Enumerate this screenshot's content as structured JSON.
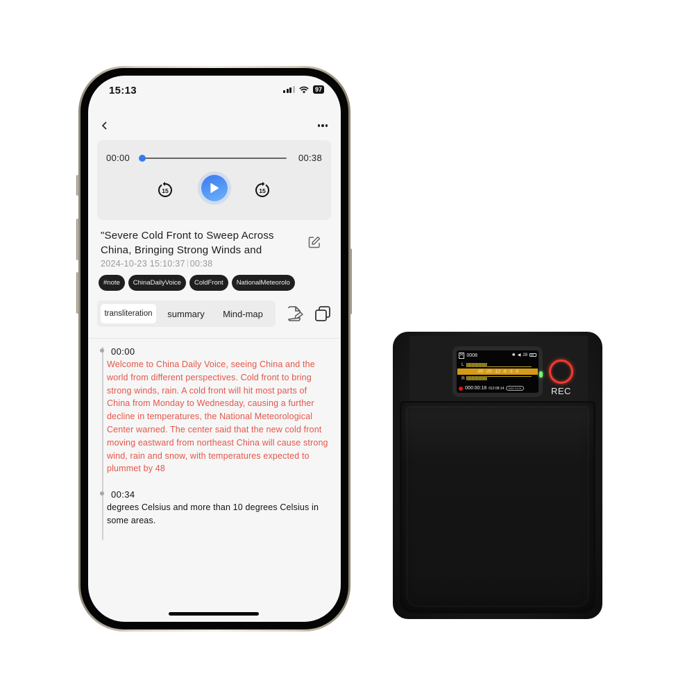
{
  "status_bar": {
    "time": "15:13",
    "battery": "97",
    "icons": [
      "signal-icon",
      "wifi-icon",
      "battery-icon"
    ]
  },
  "nav": {
    "back_icon": "chevron-left-icon",
    "more_icon": "more-horizontal-icon"
  },
  "player": {
    "current_time": "00:00",
    "total_time": "00:38",
    "progress_fraction": 0.0,
    "skip_back_label": "15",
    "skip_forward_label": "15",
    "play_icon": "play-icon",
    "accent_color": "#3a78f2"
  },
  "recording": {
    "title": "\"Severe Cold Front to Sweep Across China, Bringing Strong Winds and",
    "date": "2024-10-23 15:10:37",
    "duration": "00:38",
    "tags": [
      "#note",
      "ChinaDailyVoice",
      "ColdFront",
      "NationalMeteorolo"
    ]
  },
  "tabs": [
    {
      "label": "transliteration",
      "active": true
    },
    {
      "label": "summary",
      "active": false
    },
    {
      "label": "Mind-map",
      "active": false
    }
  ],
  "tools": [
    "note-edit-icon",
    "copy-icon"
  ],
  "transcript": [
    {
      "time": "00:00",
      "text": " Welcome to China Daily Voice, seeing China and the world from different perspectives. Cold front to bring strong winds, rain. A cold front will hit most parts of China from Monday to Wednesday, causing a further decline in temperatures, the National Meteorological Center warned. The center said that the new cold front moving eastward from northeast China will cause strong wind, rain and snow, with temperatures expected to plummet by 48",
      "highlight_color": "#e3574a"
    },
    {
      "time": "00:34",
      "text": " degrees Celsius and more than 10 degrees Celsius in some areas."
    }
  ],
  "recorder_device": {
    "file_number": "0008",
    "file_badge": "R",
    "volume": "28",
    "channels": {
      "left": "L",
      "right": "R"
    },
    "scale": [
      "-30",
      "-20",
      "-12",
      "-6",
      "-3",
      "-0"
    ],
    "elapsed": "000:00:18",
    "remaining": "012:08:14",
    "format_badge": "WAV 512K",
    "rec_label": "REC"
  }
}
